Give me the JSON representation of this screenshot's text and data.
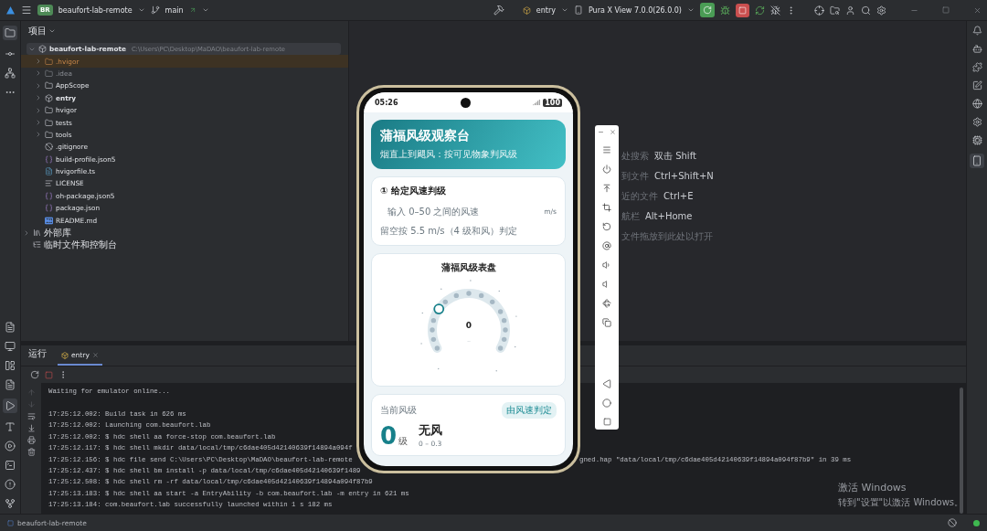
{
  "title_bar": {
    "badge": "BR",
    "project": "beaufort-lab-remote",
    "branch": "main",
    "run_config": "entry",
    "device": "Pura X View 7.0.0(26.0.0)"
  },
  "project_panel": {
    "title": "项目",
    "tree": [
      {
        "label": "beaufort-lab-remote",
        "path": "C:\\Users\\PC\\Desktop\\MaDAO\\beaufort-lab-remote",
        "kind": "module",
        "expanded": true,
        "selected": true,
        "children": [
          {
            "label": ".hvigor",
            "kind": "excluded",
            "expanded": false,
            "selected": false
          },
          {
            "label": ".idea",
            "kind": "ignored",
            "expanded": false,
            "selected": false
          },
          {
            "label": "AppScope",
            "kind": "folder",
            "expanded": false,
            "selected": false
          },
          {
            "label": "entry",
            "kind": "module",
            "expanded": false,
            "selected": false
          },
          {
            "label": "hvigor",
            "kind": "folder",
            "expanded": false,
            "selected": false
          },
          {
            "label": "tests",
            "kind": "folder",
            "expanded": false,
            "selected": false
          },
          {
            "label": "tools",
            "kind": "folder",
            "expanded": false,
            "selected": false
          },
          {
            "label": ".gitignore",
            "kind": "gitignore",
            "selected": false
          },
          {
            "label": "build-profile.json5",
            "kind": "json",
            "selected": false
          },
          {
            "label": "hvigorfile.ts",
            "kind": "ts",
            "selected": false
          },
          {
            "label": "LICENSE",
            "kind": "text",
            "selected": false
          },
          {
            "label": "oh-package.json5",
            "kind": "json",
            "selected": false
          },
          {
            "label": "package.json",
            "kind": "json",
            "selected": false
          },
          {
            "label": "README.md",
            "kind": "markdown",
            "selected": false
          }
        ]
      },
      {
        "label": "外部库",
        "kind": "library",
        "expanded": false,
        "selected": false
      },
      {
        "label": "临时文件和控制台",
        "kind": "scratch",
        "selected": false
      }
    ]
  },
  "editor_hints": [
    {
      "label": "处搜索",
      "shortcut": "双击 Shift"
    },
    {
      "label": "到文件",
      "shortcut": "Ctrl+Shift+N"
    },
    {
      "label": "近的文件",
      "shortcut": "Ctrl+E"
    },
    {
      "label": "航栏",
      "shortcut": "Alt+Home"
    },
    {
      "label": "文件拖放到此处以打开"
    }
  ],
  "run_panel": {
    "title": "运行",
    "tabs": [
      {
        "label": "entry",
        "selected": true
      }
    ],
    "console": [
      {
        "kind": "output",
        "text": "Waiting for emulator online..."
      },
      {
        "kind": "blank"
      },
      {
        "text": "17:25:12.002: Build task in 626 ms"
      },
      {
        "text": "17:25:12.002: Launching com.beaufort.lab"
      },
      {
        "text": "17:25:12.002: $ hdc shell aa force-stop com.beaufort.lab"
      },
      {
        "text": "17:25:12.117: $ hdc shell mkdir data/local/tmp/c6dae405d42140639f14894a094f"
      },
      {
        "text": "17:25:12.156: $ hdc file send C:\\Users\\PC\\Desktop\\MaDAO\\beaufort-lab-remote",
        "tail": "gned.hap \"data/local/tmp/c6dae405d42140639f14894a094f87b9\" in 39 ms"
      },
      {
        "text": "17:25:12.437: $ hdc shell bm install -p data/local/tmp/c6dae405d42140639f1489"
      },
      {
        "text": "17:25:12.508: $ hdc shell rm -rf data/local/tmp/c6dae405d42140639f14894a094f87b9"
      },
      {
        "text": "17:25:13.183: $ hdc shell aa start -a EntryAbility -b com.beaufort.lab -m entry in 621 ms"
      },
      {
        "text": "17:25:13.184: com.beaufort.lab successfully launched within 1 s 182 ms"
      }
    ]
  },
  "status_bar": {
    "project": "beaufort-lab-remote"
  },
  "windows_notice": {
    "title": "激活 Windows",
    "text": "转到\"设置\"以激活 Windows。"
  },
  "phone": {
    "time": "05:26",
    "battery": "100",
    "header": {
      "title": "蒲福风级观察台",
      "subtitle": "烟直上到飓风：按可见物象判风级"
    },
    "input_card": {
      "title": "① 给定风速判级",
      "placeholder": "输入 0–50 之间的风速",
      "unit": "m/s",
      "note": "留空按 5.5 m/s（4 级和风）判定"
    },
    "dial_card": {
      "title": "蒲福风级表盘",
      "value": "0",
      "label": "--"
    },
    "result_card": {
      "title": "当前风级",
      "badge": "由风速判定",
      "level": "0",
      "level_unit": "级",
      "name": "无风",
      "range": "0 – 0.3"
    }
  }
}
